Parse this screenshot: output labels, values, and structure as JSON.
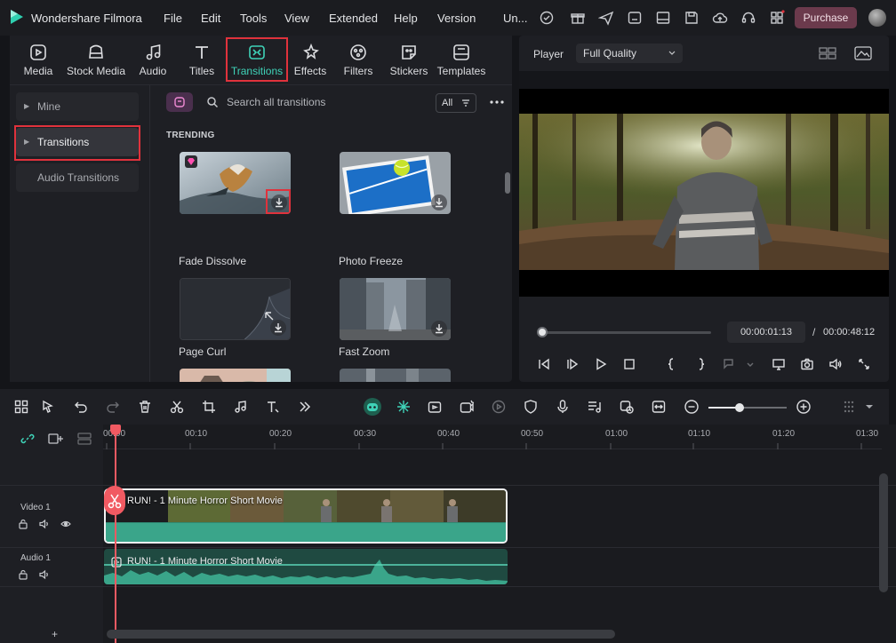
{
  "app": {
    "title": "Wondershare Filmora",
    "purchase": "Purchase"
  },
  "menu": [
    "File",
    "Edit",
    "Tools",
    "View",
    "Extended",
    "Help",
    "Version",
    "Un..."
  ],
  "media_tabs": [
    "Media",
    "Stock Media",
    "Audio",
    "Titles",
    "Transitions",
    "Effects",
    "Filters",
    "Stickers",
    "Templates"
  ],
  "categories": {
    "mine": "Mine",
    "transitions": "Transitions",
    "audio": "Audio Transitions"
  },
  "search": {
    "placeholder": "Search all transitions",
    "filter": "All"
  },
  "section": "TRENDING",
  "transitions": [
    "Fade Dissolve",
    "Photo Freeze",
    "Page Curl",
    "Fast Zoom"
  ],
  "player": {
    "label": "Player",
    "quality": "Full Quality",
    "current": "00:00:01:13",
    "separator": "/",
    "total": "00:00:48:12",
    "progress": 0.03
  },
  "ruler": [
    "00:00",
    "00:10",
    "00:20",
    "00:30",
    "00:40",
    "00:50",
    "01:00",
    "01:10",
    "01:20",
    "01:30"
  ],
  "tracks": {
    "video": "Video 1",
    "audio": "Audio 1"
  },
  "clip": {
    "title": "RUN! - 1 Minute Horror Short Movie"
  },
  "timeline": {
    "add": "+"
  },
  "colors": {
    "accent": "#3fd3b8",
    "highlight": "#e0323c",
    "playhead": "#f15a62",
    "purchase": "#6b3a4c"
  }
}
